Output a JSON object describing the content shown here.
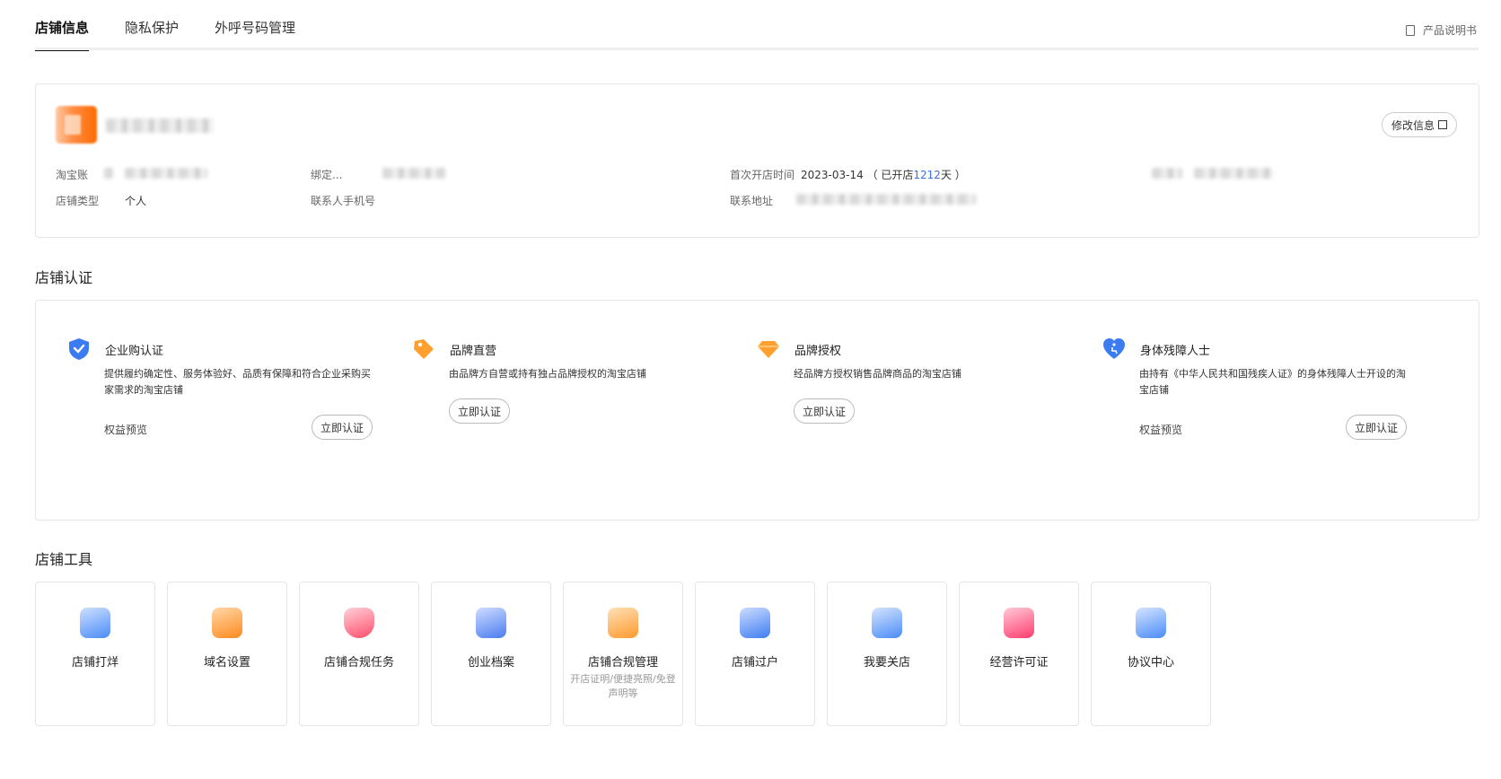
{
  "tabs": [
    {
      "label": "店铺信息",
      "active": true
    },
    {
      "label": "隐私保护",
      "active": false
    },
    {
      "label": "外呼号码管理",
      "active": false
    }
  ],
  "manual_label": "产品说明书",
  "shop": {
    "edit_label": "修改信息",
    "taobao_label": "淘宝账",
    "bind_label": "绑定...",
    "open_time_label": "首次开店时间",
    "open_date": "2023-03-14",
    "open_prefix": "（ 已开店",
    "open_days": "1212",
    "open_suffix": "天 ）",
    "type_label": "店铺类型",
    "type_value": "个人",
    "phone_label": "联系人手机号",
    "address_label": "联系地址"
  },
  "cert_section_title": "店铺认证",
  "certs": [
    {
      "title": "企业购认证",
      "desc": "提供履约确定性、服务体验好、品质有保障和符合企业采购买家需求的淘宝店铺",
      "link": "权益预览",
      "button": "立即认证"
    },
    {
      "title": "品牌直营",
      "desc": "由品牌方自营或持有独占品牌授权的淘宝店铺",
      "button": "立即认证"
    },
    {
      "title": "品牌授权",
      "desc": "经品牌方授权销售品牌商品的淘宝店铺",
      "button": "立即认证"
    },
    {
      "title": "身体残障人士",
      "desc": "由持有《中华人民共和国残疾人证》的身体残障人士开设的淘宝店铺",
      "link": "权益预览",
      "button": "立即认证"
    }
  ],
  "tools_section_title": "店铺工具",
  "tools": [
    {
      "label": "店铺打烊",
      "icon": "shop-closed-icon",
      "color": "#4a8cf7"
    },
    {
      "label": "域名设置",
      "icon": "domain-icon",
      "color": "#ff8a1f"
    },
    {
      "label": "店铺合规任务",
      "icon": "shield-search-icon",
      "color": "#ff4d6a"
    },
    {
      "label": "创业档案",
      "icon": "archive-icon",
      "color": "#4a7df0"
    },
    {
      "label": "店铺合规管理",
      "sub": "开店证明/便捷亮照/免登声明等",
      "icon": "compliance-doc-icon",
      "color": "#ff9a2e"
    },
    {
      "label": "店铺过户",
      "icon": "transfer-icon",
      "color": "#3f7df2"
    },
    {
      "label": "我要关店",
      "icon": "close-shop-icon",
      "color": "#4a8cf7"
    },
    {
      "label": "经营许可证",
      "icon": "license-icon",
      "color": "#ff3d6e"
    },
    {
      "label": "协议中心",
      "icon": "agreement-icon",
      "color": "#4a8cf7"
    }
  ]
}
